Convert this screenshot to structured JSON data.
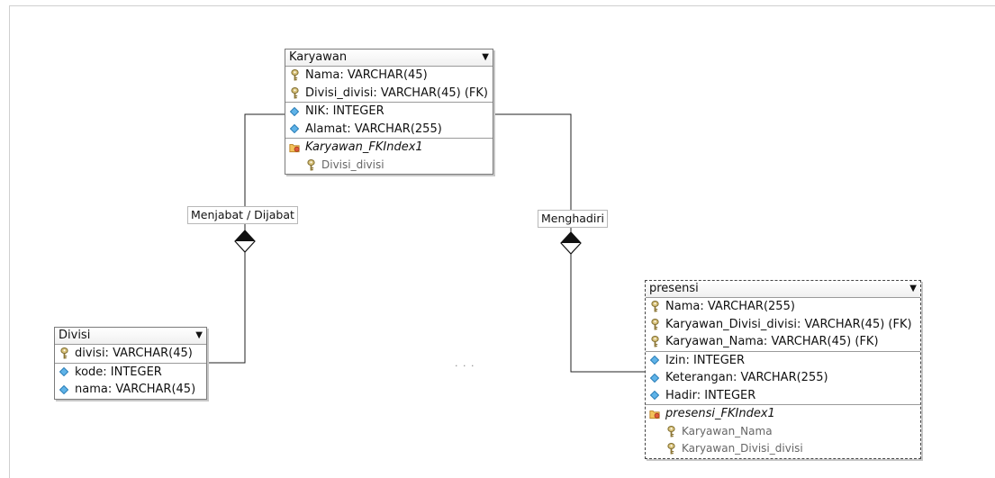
{
  "entities": {
    "karyawan": {
      "title": "Karyawan",
      "pk_fields": [
        "Nama: VARCHAR(45)",
        "Divisi_divisi: VARCHAR(45) (FK)"
      ],
      "fields": [
        "NIK: INTEGER",
        "Alamat: VARCHAR(255)"
      ],
      "index": {
        "name": "Karyawan_FKIndex1",
        "columns": [
          "Divisi_divisi"
        ]
      }
    },
    "divisi": {
      "title": "Divisi",
      "pk_fields": [
        "divisi: VARCHAR(45)"
      ],
      "fields": [
        "kode: INTEGER",
        "nama: VARCHAR(45)"
      ]
    },
    "presensi": {
      "title": "presensi",
      "pk_fields": [
        "Nama: VARCHAR(255)",
        "Karyawan_Divisi_divisi: VARCHAR(45) (FK)",
        "Karyawan_Nama: VARCHAR(45) (FK)"
      ],
      "fields": [
        "Izin: INTEGER",
        "Keterangan: VARCHAR(255)",
        "Hadir: INTEGER"
      ],
      "index": {
        "name": "presensi_FKIndex1",
        "columns": [
          "Karyawan_Nama",
          "Karyawan_Divisi_divisi"
        ]
      }
    }
  },
  "relationships": {
    "menjabat": "Menjabat / Dijabat",
    "menghadiri": "Menghadiri"
  },
  "misc": {
    "dots": "· · ·"
  },
  "colors": {
    "key_icon": "#b8a25a",
    "attr_icon": "#3f9ad6",
    "index_icon": "#e8a23a",
    "line": "#222222"
  }
}
